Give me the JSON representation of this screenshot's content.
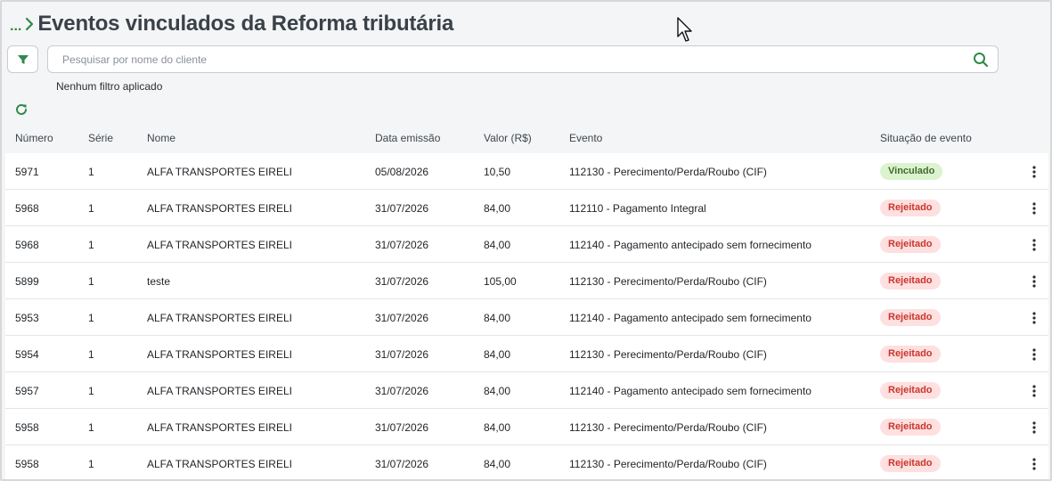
{
  "breadcrumb": {
    "ellipsis": "...",
    "title": "Eventos vinculados da Reforma tributária"
  },
  "search": {
    "placeholder": "Pesquisar por nome do cliente",
    "value": ""
  },
  "filter_status": "Nenhum filtro aplicado",
  "icons": {
    "filter": "filter-funnel-icon",
    "search": "search-icon",
    "refresh": "refresh-icon",
    "more": "more-vertical-icon",
    "cursor": "mouse-pointer-icon"
  },
  "colors": {
    "accent": "#2f8a4a",
    "title": "#3a4149",
    "vinculado_bg": "#dcf3cf",
    "vinculado_text": "#3e6b2c",
    "rejeitado_bg": "#fde0df",
    "rejeitado_text": "#c9362e"
  },
  "table": {
    "columns": [
      "Número",
      "Série",
      "Nome",
      "Data emissão",
      "Valor (R$)",
      "Evento",
      "Situação de evento"
    ],
    "rows": [
      {
        "numero": "5971",
        "serie": "1",
        "nome": "ALFA TRANSPORTES EIRELI",
        "data": "05/08/2026",
        "valor": "10,50",
        "evento": "112130 - Perecimento/Perda/Roubo (CIF)",
        "situacao": "Vinculado",
        "status": "ok"
      },
      {
        "numero": "5968",
        "serie": "1",
        "nome": "ALFA TRANSPORTES EIRELI",
        "data": "31/07/2026",
        "valor": "84,00",
        "evento": "112110 - Pagamento Integral",
        "situacao": "Rejeitado",
        "status": "bad"
      },
      {
        "numero": "5968",
        "serie": "1",
        "nome": "ALFA TRANSPORTES EIRELI",
        "data": "31/07/2026",
        "valor": "84,00",
        "evento": "112140 - Pagamento antecipado sem fornecimento",
        "situacao": "Rejeitado",
        "status": "bad"
      },
      {
        "numero": "5899",
        "serie": "1",
        "nome": "teste",
        "data": "31/07/2026",
        "valor": "105,00",
        "evento": "112130 - Perecimento/Perda/Roubo (CIF)",
        "situacao": "Rejeitado",
        "status": "bad"
      },
      {
        "numero": "5953",
        "serie": "1",
        "nome": "ALFA TRANSPORTES EIRELI",
        "data": "31/07/2026",
        "valor": "84,00",
        "evento": "112140 - Pagamento antecipado sem fornecimento",
        "situacao": "Rejeitado",
        "status": "bad"
      },
      {
        "numero": "5954",
        "serie": "1",
        "nome": "ALFA TRANSPORTES EIRELI",
        "data": "31/07/2026",
        "valor": "84,00",
        "evento": "112130 - Perecimento/Perda/Roubo (CIF)",
        "situacao": "Rejeitado",
        "status": "bad"
      },
      {
        "numero": "5957",
        "serie": "1",
        "nome": "ALFA TRANSPORTES EIRELI",
        "data": "31/07/2026",
        "valor": "84,00",
        "evento": "112140 - Pagamento antecipado sem fornecimento",
        "situacao": "Rejeitado",
        "status": "bad"
      },
      {
        "numero": "5958",
        "serie": "1",
        "nome": "ALFA TRANSPORTES EIRELI",
        "data": "31/07/2026",
        "valor": "84,00",
        "evento": "112130 - Perecimento/Perda/Roubo (CIF)",
        "situacao": "Rejeitado",
        "status": "bad"
      },
      {
        "numero": "5958",
        "serie": "1",
        "nome": "ALFA TRANSPORTES EIRELI",
        "data": "31/07/2026",
        "valor": "84,00",
        "evento": "112130 - Perecimento/Perda/Roubo (CIF)",
        "situacao": "Rejeitado",
        "status": "bad"
      }
    ]
  }
}
